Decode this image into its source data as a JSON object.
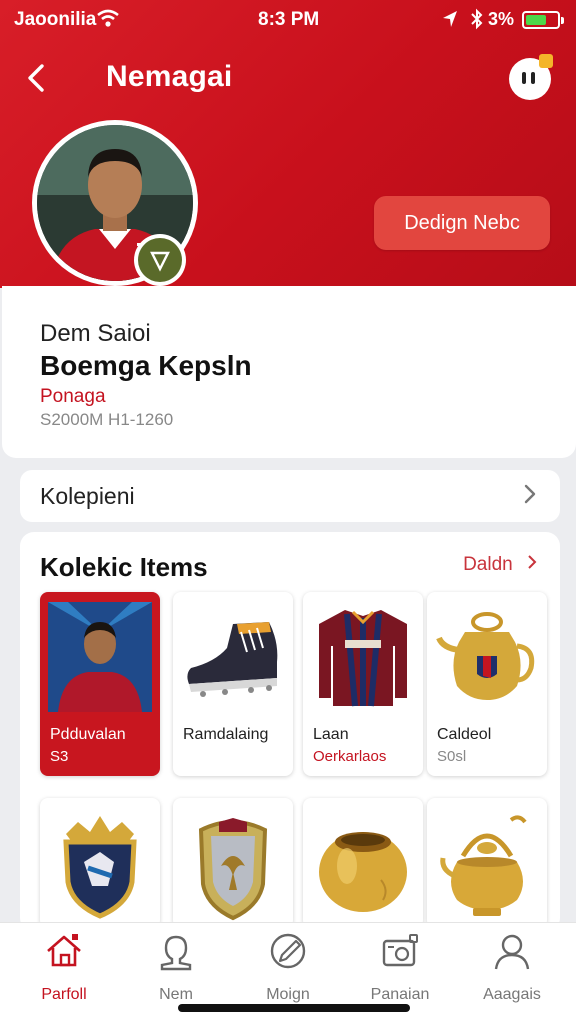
{
  "status_bar": {
    "carrier": "Jaoonilia",
    "time": "8:3 PM",
    "battery_percent": "3%",
    "battery_level": 0.68
  },
  "header": {
    "title": "Nemagai",
    "cta_label": "Dedign Nebc"
  },
  "profile": {
    "subtitle": "Dem Saioi",
    "name": "Boemga Kepsln",
    "position": "Ponaga",
    "meta": "S2000M H1-1260"
  },
  "collection_row": {
    "label": "Kolepieni"
  },
  "items_section": {
    "title": "Kolekic Items",
    "see_all": "Daldn",
    "items": [
      {
        "name": "Pdduvalan",
        "price": "S3",
        "active": true,
        "icon": "player-card-icon"
      },
      {
        "name": "Ramdalaing",
        "price": "",
        "active": false,
        "icon": "football-boot-icon"
      },
      {
        "name": "Laan",
        "price": "Oerkarlaos",
        "active": false,
        "icon": "jersey-icon"
      },
      {
        "name": "Caldeol",
        "price": "S0sl",
        "active": false,
        "icon": "golden-teapot-icon"
      }
    ],
    "items_row2": [
      {
        "icon": "crest-shield-icon"
      },
      {
        "icon": "eagle-shield-icon"
      },
      {
        "icon": "golden-bowl-icon"
      },
      {
        "icon": "golden-kettle-icon"
      }
    ]
  },
  "tabs": [
    {
      "label": "Parfoll",
      "icon": "home-icon",
      "active": true
    },
    {
      "label": "Nem",
      "icon": "person-icon",
      "active": false
    },
    {
      "label": "Moign",
      "icon": "compass-icon",
      "active": false
    },
    {
      "label": "Panaian",
      "icon": "camera-icon",
      "active": false
    },
    {
      "label": "Aaagais",
      "icon": "profile-icon",
      "active": false
    }
  ],
  "colors": {
    "brand_red": "#c8101c",
    "cta_red": "#e2463f",
    "gold": "#d4a83a"
  }
}
